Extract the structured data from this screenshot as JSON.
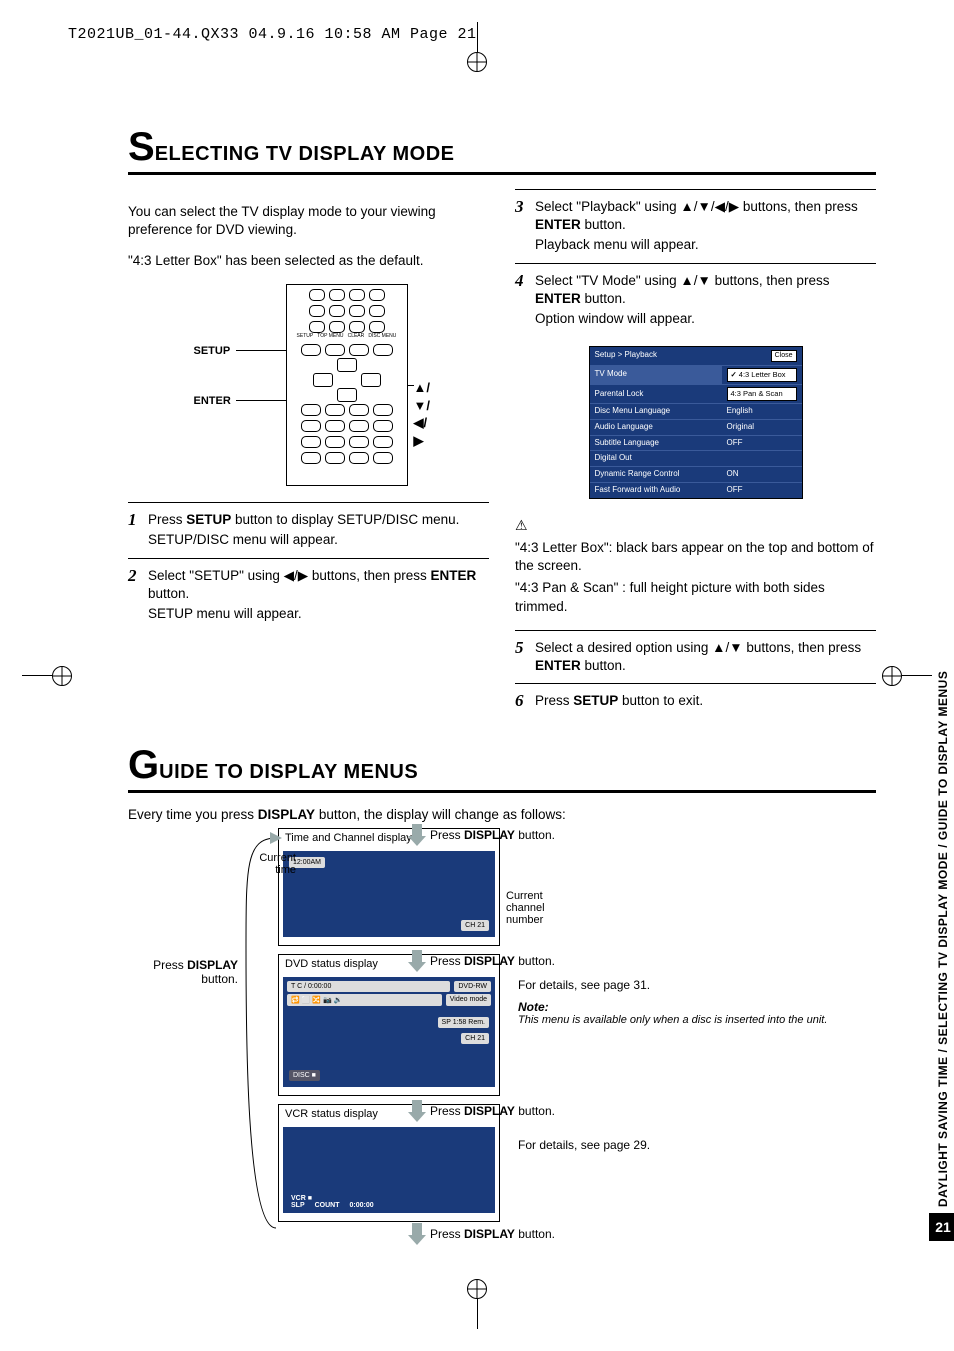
{
  "prepress": "T2021UB_01-44.QX33  04.9.16  10:58 AM  Page 21",
  "section1": {
    "big": "S",
    "rest": "ELECTING TV DISPLAY MODE",
    "intro1": "You can select the TV display mode to your viewing preference for DVD viewing.",
    "intro2": "\"4:3 Letter Box\" has been selected as the default.",
    "labels": {
      "setup": "SETUP",
      "enter": "ENTER",
      "arrows": "▲/▼/◀/▶"
    },
    "steps_left": [
      {
        "num": "1",
        "lines": [
          "Press <b>SETUP</b> button to display SETUP/DISC menu.",
          "SETUP/DISC menu will appear."
        ]
      },
      {
        "num": "2",
        "lines": [
          "Select \"SETUP\" using ◀/▶ buttons, then press <b>ENTER</b> button.",
          "SETUP menu will appear."
        ]
      }
    ],
    "steps_right": [
      {
        "num": "3",
        "lines": [
          "Select \"Playback\" using ▲/▼/◀/▶ buttons, then press <b>ENTER</b> button.",
          "Playback menu will appear."
        ]
      },
      {
        "num": "4",
        "lines": [
          "Select \"TV Mode\" using ▲/▼ buttons, then press <b>ENTER</b> button.",
          "Option window will appear."
        ]
      }
    ],
    "osd": {
      "breadcrumb": "Setup > Playback",
      "close": "Close",
      "rows": [
        {
          "k": "TV Mode",
          "v": ""
        },
        {
          "k": "Parental Lock",
          "v": ""
        },
        {
          "k": "Disc Menu Language",
          "v": "English"
        },
        {
          "k": "Audio Language",
          "v": "Original"
        },
        {
          "k": "Subtitle Language",
          "v": "OFF"
        },
        {
          "k": "Digital Out",
          "v": ""
        },
        {
          "k": "Dynamic Range Control",
          "v": "ON"
        },
        {
          "k": "Fast Forward with Audio",
          "v": "OFF"
        }
      ],
      "options": [
        "4:3 Letter Box",
        "4:3 Pan & Scan"
      ]
    },
    "warn": [
      "\"4:3 Letter Box\": black bars appear on the top and bottom of the screen.",
      "\"4:3 Pan & Scan\" : full height picture with both sides trimmed."
    ],
    "steps_right2": [
      {
        "num": "5",
        "lines": [
          "Select a desired option using ▲/▼ buttons, then press <b>ENTER</b> button."
        ]
      },
      {
        "num": "6",
        "lines": [
          "Press <b>SETUP</b> button to exit."
        ]
      }
    ]
  },
  "section2": {
    "big": "G",
    "rest": "UIDE TO DISPLAY MENUS",
    "intro": "Every time you press <b>DISPLAY</b> button, the display will change as follows:",
    "left_label": "Press <b>DISPLAY</b> button.",
    "blocks": {
      "time": {
        "title": "Time and Channel display",
        "cur_time_label": "Current time",
        "cur_time_value": "12:00AM",
        "cur_ch_label": "Current channel number",
        "cur_ch_value": "CH 21"
      },
      "dvd": {
        "title": "DVD status display",
        "details": "For details, see page 31.",
        "note_title": "Note:",
        "note_body": "This menu is available only when a disc is inserted into the unit.",
        "osd_line1a": "T    C    /    0:00:00",
        "osd_line1b": "DVD-RW",
        "osd_line2a": "🔁  ⬜  🔀  📷  🔉",
        "osd_line2b": "Video mode",
        "osd_line3": "SP 1:58 Rem.",
        "osd_ch": "CH 21",
        "disc": "DISC ■"
      },
      "vcr": {
        "title": "VCR status display",
        "details": "For details, see page 29.",
        "line1a": "VCR ■",
        "line2a": "SLP",
        "line2b": "COUNT",
        "line2c": "0:00:00"
      }
    },
    "press": "Press <b>DISPLAY</b> button."
  },
  "side": {
    "text": "DAYLIGHT SAVING TIME / SELECTING TV DISPLAY MODE / GUIDE TO DISPLAY MENUS",
    "page": "21"
  }
}
